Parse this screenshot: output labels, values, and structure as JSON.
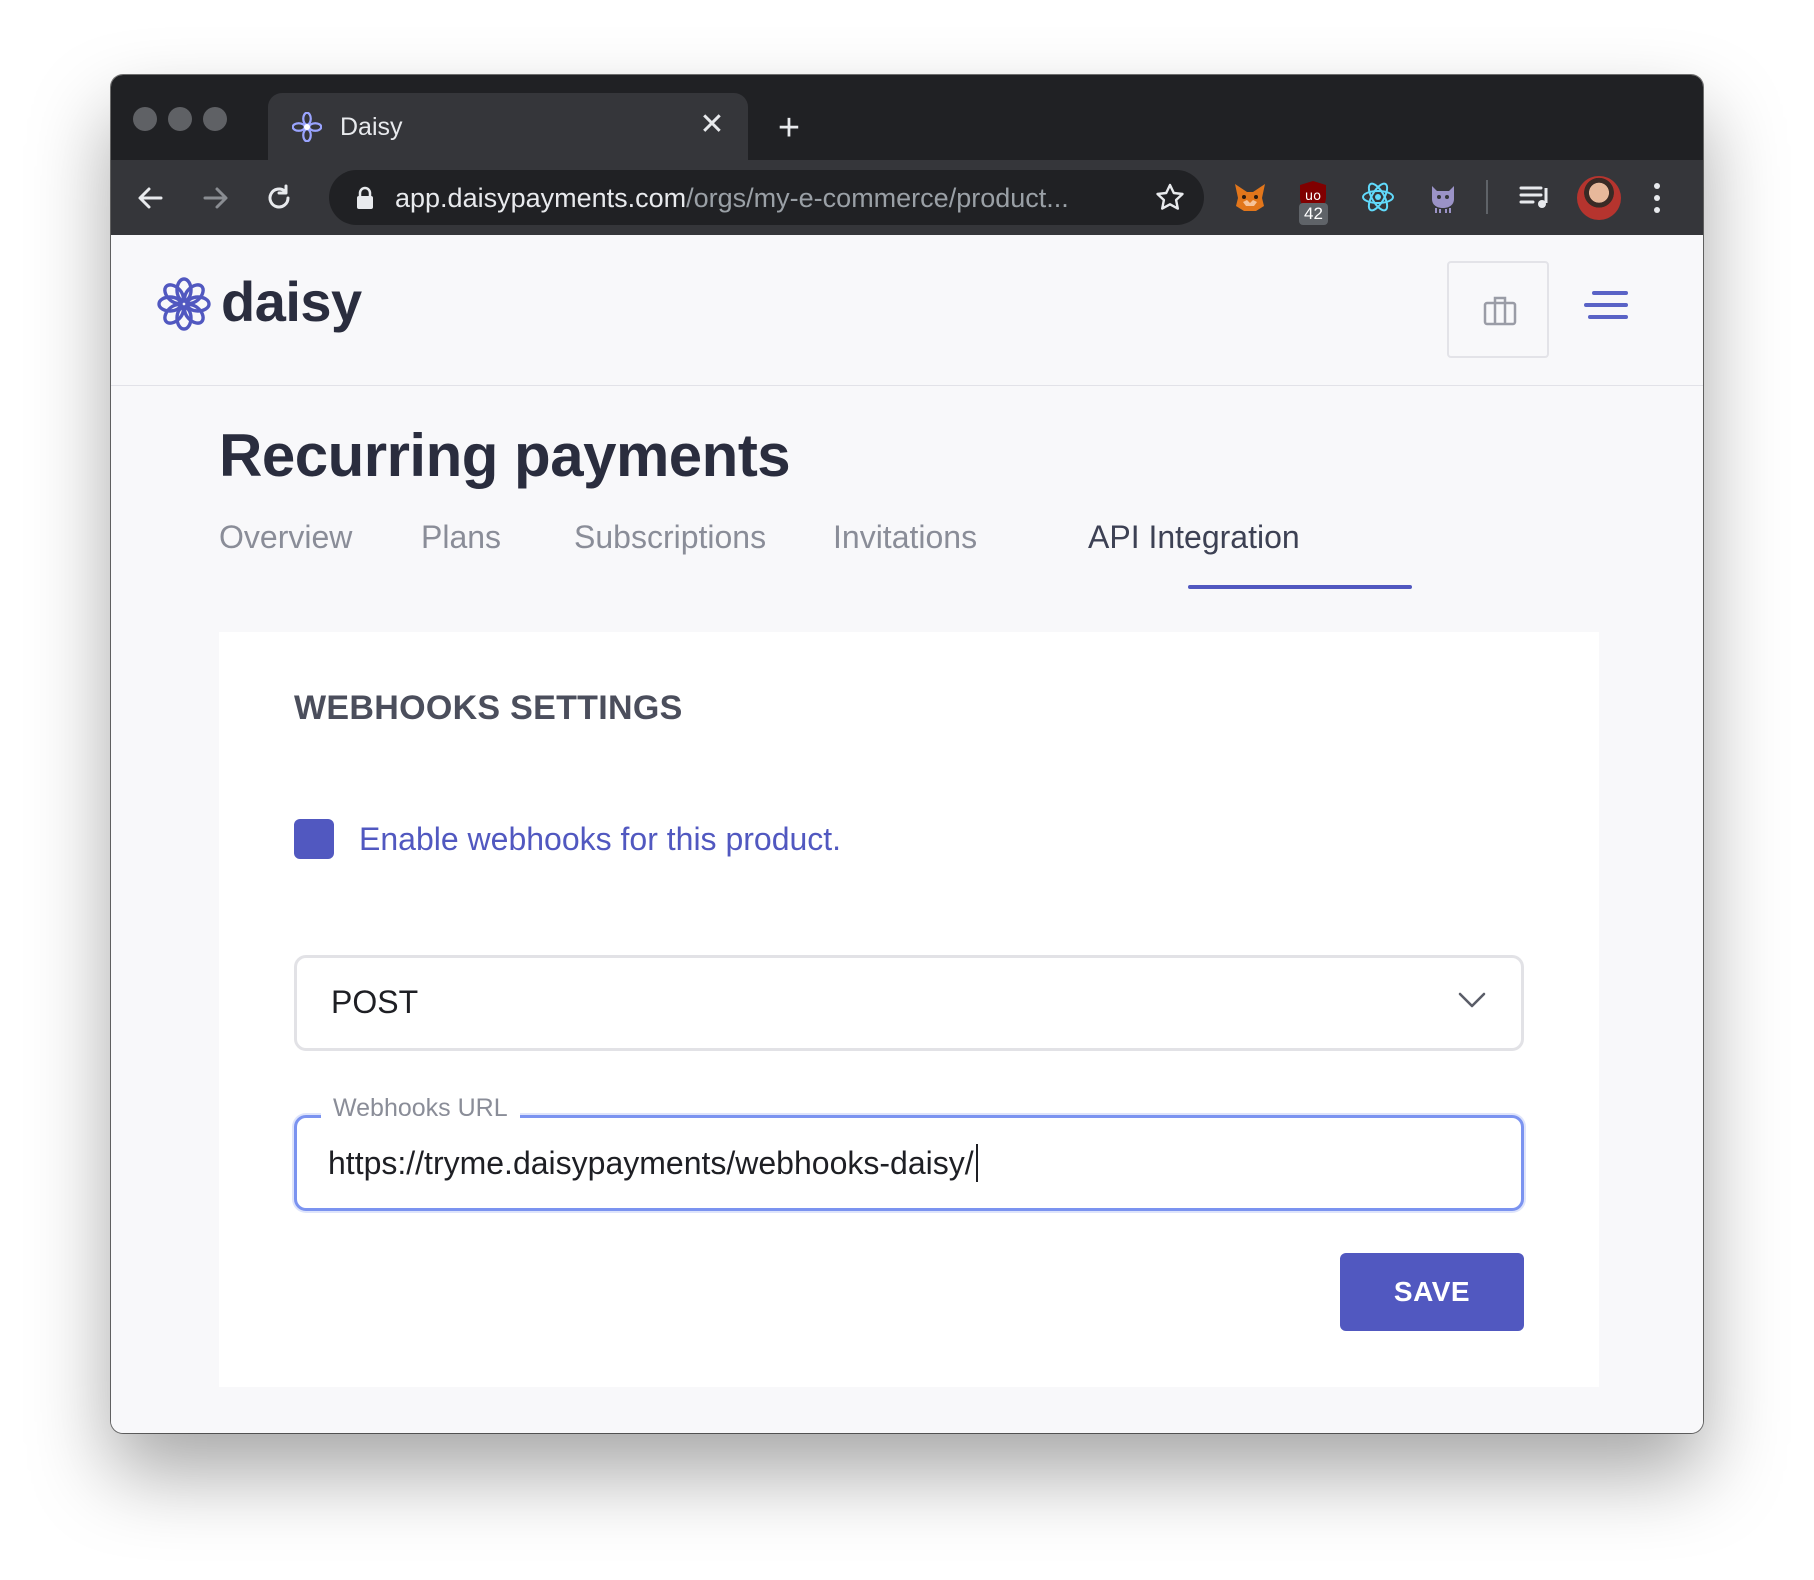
{
  "browser": {
    "tab_title": "Daisy",
    "url_host": "app.daisypayments.com",
    "url_path": "/orgs/my-e-commerce/product...",
    "extension_badge": "42",
    "colors": {
      "frame": "#202124",
      "toolbar": "#35363a"
    }
  },
  "app": {
    "logo_text": "daisy",
    "brand_color": "#5158c0"
  },
  "page": {
    "title": "Recurring payments",
    "tabs": [
      {
        "label": "Overview",
        "active": false
      },
      {
        "label": "Plans",
        "active": false
      },
      {
        "label": "Subscriptions",
        "active": false
      },
      {
        "label": "Invitations",
        "active": false
      },
      {
        "label": "API Integration",
        "active": true
      }
    ]
  },
  "webhooks": {
    "section_title": "WEBHOOKS SETTINGS",
    "enable_label": "Enable webhooks for this product.",
    "enabled": true,
    "method_value": "POST",
    "url_label": "Webhooks URL",
    "url_value": "https://tryme.daisypayments/webhooks-daisy/",
    "save_label": "SAVE"
  }
}
